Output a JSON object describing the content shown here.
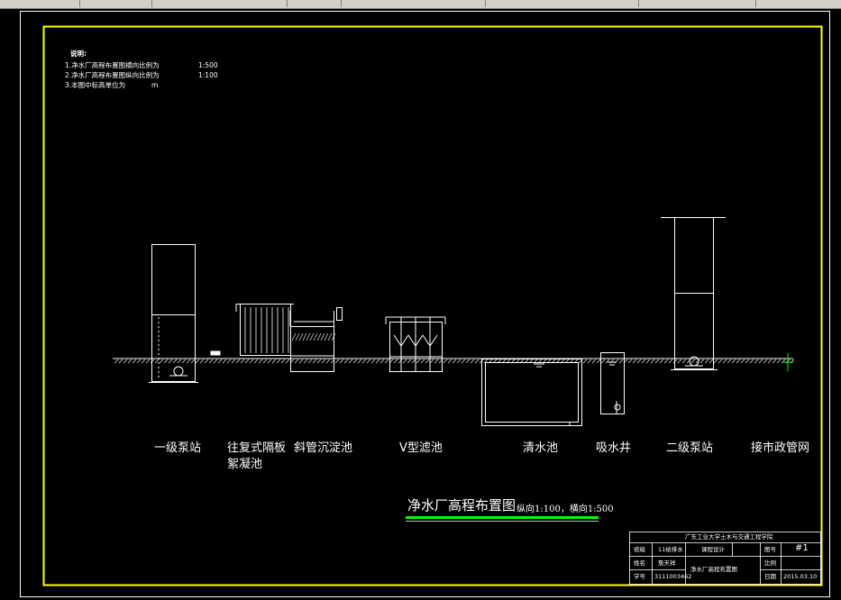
{
  "notes": {
    "heading": "说明:",
    "items": [
      {
        "text": "1.净水厂高程布置图横向比例为",
        "value": "1:500"
      },
      {
        "text": "2.净水厂高程布置图纵向比例为",
        "value": "1:100"
      },
      {
        "text": "3.本图中标高单位为",
        "value": "m"
      }
    ]
  },
  "structures": {
    "primary_pump": "一级泵站",
    "flocculation_line1": "往复式隔板",
    "flocculation_line2": "絮凝池",
    "sedimentation": "斜管沉淀池",
    "v_filter": "V型滤池",
    "clear_well": "清水池",
    "suction_well": "吸水井",
    "secondary_pump": "二级泵站",
    "municipal": "接市政管网"
  },
  "title": {
    "main": "净水厂高程布置图",
    "scale": "纵向1:100，横向1:500"
  },
  "title_block": {
    "institution": "广东工业大学土木与交通工程学院",
    "class_label": "班级",
    "class_value": "11给排水",
    "design_label": "课程设计",
    "name_label": "姓名",
    "name_value": "詹天祥",
    "id_label": "学号",
    "id_value": "3111003462",
    "drawing_title": "净水厂高程布置图",
    "drawing_no_label": "图号",
    "drawing_no_value": "#1",
    "scale_label": "比例",
    "date_label": "日期",
    "date_value": "2015.03.10"
  },
  "colors": {
    "background": "#000000",
    "frame": "#ffff00",
    "lines": "#ffffff",
    "underline": "#00ff00"
  }
}
